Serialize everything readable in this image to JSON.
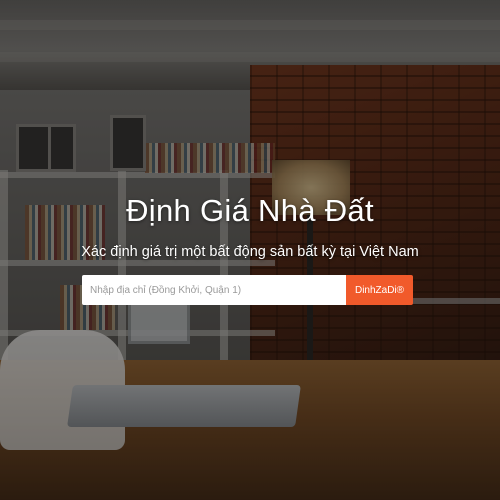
{
  "hero": {
    "title": "Định Giá Nhà Đất",
    "subtitle": "Xác định giá trị một bất động sản bất kỳ tại Việt Nam"
  },
  "search": {
    "placeholder": "Nhập địa chỉ (Đồng Khởi, Quận 1)",
    "value": "",
    "button_label": "DinhZaDi®"
  },
  "colors": {
    "accent": "#f15a2b",
    "text": "#ffffff",
    "overlay": "rgba(0,0,0,0.42)"
  },
  "background": {
    "icon": "interior-photo"
  }
}
